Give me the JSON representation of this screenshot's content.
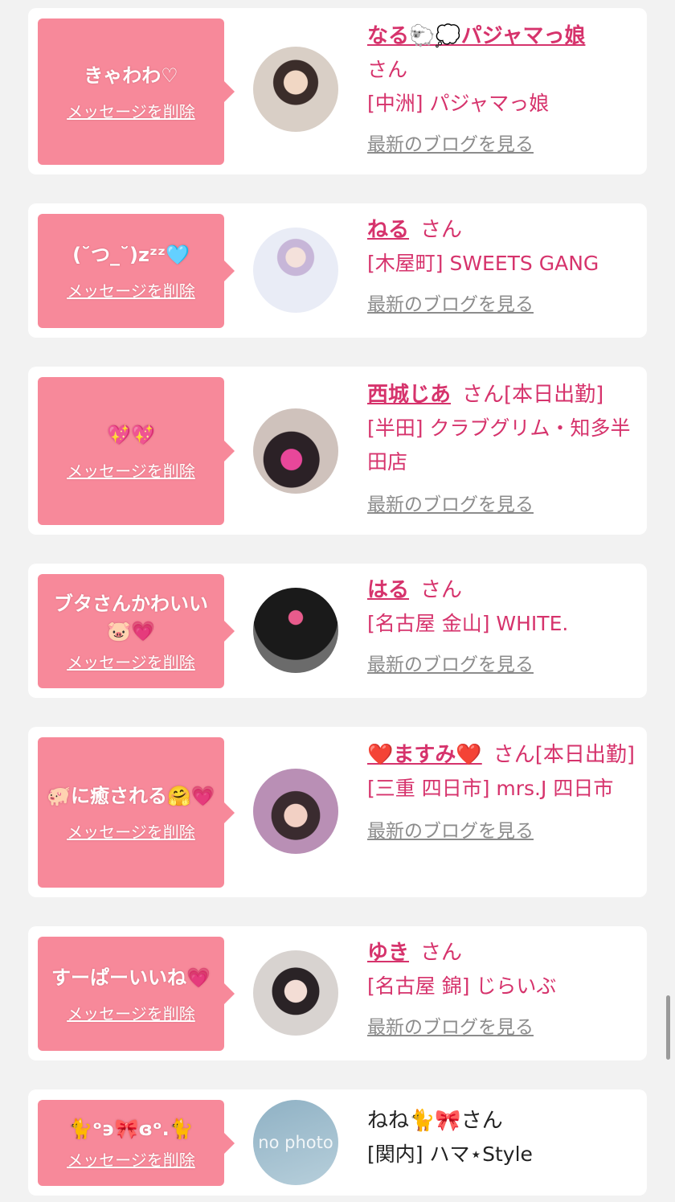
{
  "delete_label": "メッセージを削除",
  "blog_label": "最新のブログを見る",
  "san_label": "さん",
  "accent_color": "#f7899a",
  "name_color": "#d6336c",
  "icons": {
    "avatar": "profile-photo",
    "no_photo_text": "no photo"
  },
  "items": [
    {
      "message": "きゃわわ♡",
      "name": "なる🐑💭パジャマっ娘",
      "san": "さん",
      "shop": "[中洲] パジャマっ娘"
    },
    {
      "message": "(˘つ_˘)zᶻᶻ🩵",
      "name": "ねる",
      "san": "さん",
      "shop": "[木屋町] SWEETS GANG"
    },
    {
      "message": "💖💖",
      "name": "西城じあ",
      "san": "さん[本日出勤]",
      "shop": "[半田] クラブグリム・知多半田店"
    },
    {
      "message": "ブタさんかわいい🐷💗",
      "name": "はる",
      "san": "さん",
      "shop": "[名古屋 金山] WHITE."
    },
    {
      "message": "🐖に癒される🤗💗",
      "name": "❤️ますみ❤️",
      "san": "さん[本日出勤]",
      "shop": "[三重 四日市] mrs.J 四日市"
    },
    {
      "message": "すーぱーいいね💗",
      "name": "ゆき",
      "san": "さん",
      "shop": "[名古屋 錦] じらいぶ"
    },
    {
      "message": "🐈ᵒ϶🎀ɞᵒ.🐈",
      "name": "ねね🐈🎀",
      "san": "さん",
      "shop": "[関内] ハマ⋆Style"
    }
  ]
}
